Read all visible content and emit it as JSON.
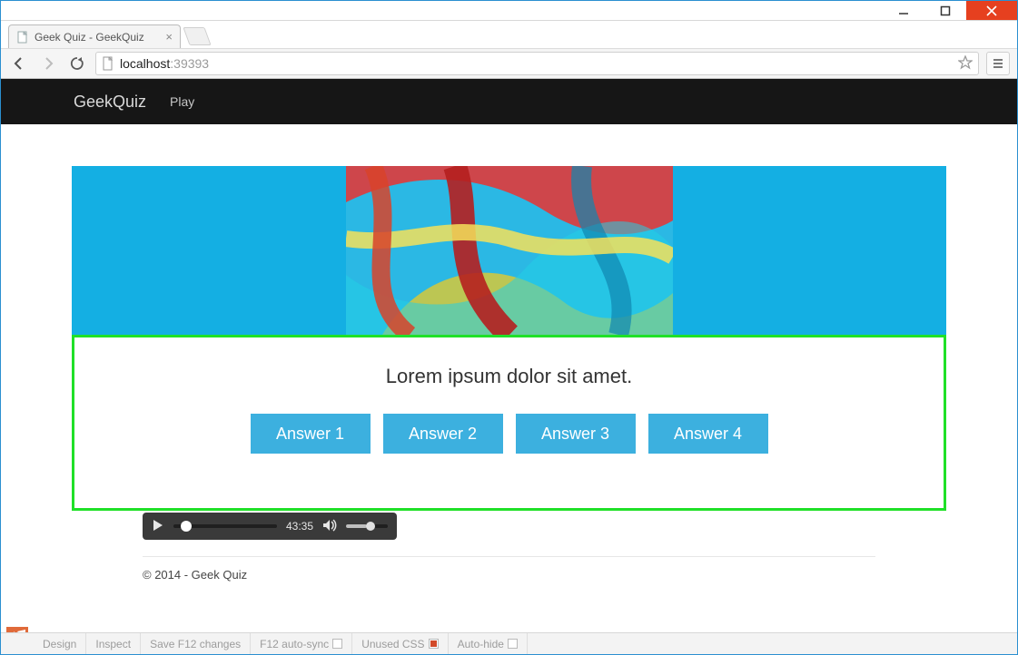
{
  "window": {
    "tab_title": "Geek Quiz - GeekQuiz"
  },
  "address": {
    "host": "localhost",
    "port": ":39393"
  },
  "site": {
    "brand": "GeekQuiz",
    "nav": {
      "play": "Play"
    }
  },
  "quiz": {
    "question": "Lorem ipsum dolor sit amet.",
    "answers": [
      "Answer 1",
      "Answer 2",
      "Answer 3",
      "Answer 4"
    ]
  },
  "player": {
    "time": "43:35"
  },
  "footer": {
    "copyright": "© 2014 - Geek Quiz"
  },
  "browserlink": {
    "design": "Design",
    "inspect": "Inspect",
    "save": "Save F12 changes",
    "autosync": "F12 auto-sync",
    "unused": "Unused CSS",
    "autohide": "Auto-hide"
  }
}
